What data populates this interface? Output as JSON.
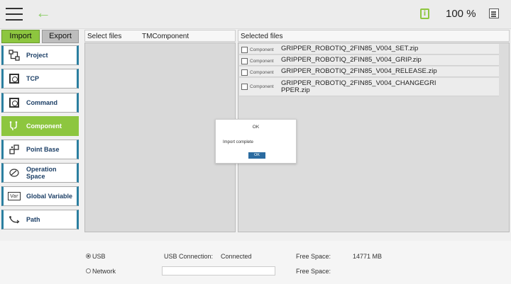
{
  "topbar": {
    "zoom": "100 %"
  },
  "tabs": {
    "import_label": "Import",
    "export_label": "Export"
  },
  "sidebar": {
    "items": [
      {
        "label": "Project",
        "icon": "project-icon"
      },
      {
        "label": "TCP",
        "icon": "tcp-icon"
      },
      {
        "label": "Command",
        "icon": "command-icon"
      },
      {
        "label": "Component",
        "icon": "component-icon",
        "active": true
      },
      {
        "label": "Point Base",
        "icon": "point-base-icon"
      },
      {
        "label": "Operation Space",
        "icon": "operation-space-icon"
      },
      {
        "label": "Global Variable",
        "icon": "global-variable-icon"
      },
      {
        "label": "Path",
        "icon": "path-icon"
      }
    ]
  },
  "main": {
    "select_files_label": "Select files",
    "select_files_folder": "TMComponent",
    "selected_files_label": "Selected files",
    "files": [
      {
        "tag": "Component",
        "name": "GRIPPER_ROBOTIQ_2FIN85_V004_SET.zip"
      },
      {
        "tag": "Component",
        "name": "GRIPPER_ROBOTIQ_2FIN85_V004_GRIP.zip"
      },
      {
        "tag": "Component",
        "name": "GRIPPER_ROBOTIQ_2FIN85_V004_RELEASE.zip"
      },
      {
        "tag": "Component",
        "name": "GRIPPER_ROBOTIQ_2FIN85_V004_CHANGEGRIPPER.zip"
      }
    ]
  },
  "dialog": {
    "title": "OK",
    "message": "Import complete",
    "button": "OK"
  },
  "bottom": {
    "usb_label": "USB",
    "network_label": "Network",
    "usb_connection_label": "USB Connection:",
    "usb_connection_value": "Connected",
    "free_space_label": "Free Space:",
    "free_space_value": "14771 MB",
    "free_space_label_2": "Free Space:"
  },
  "colors": {
    "accent_green": "#8dc63f",
    "accent_blue": "#2b7fa0"
  }
}
